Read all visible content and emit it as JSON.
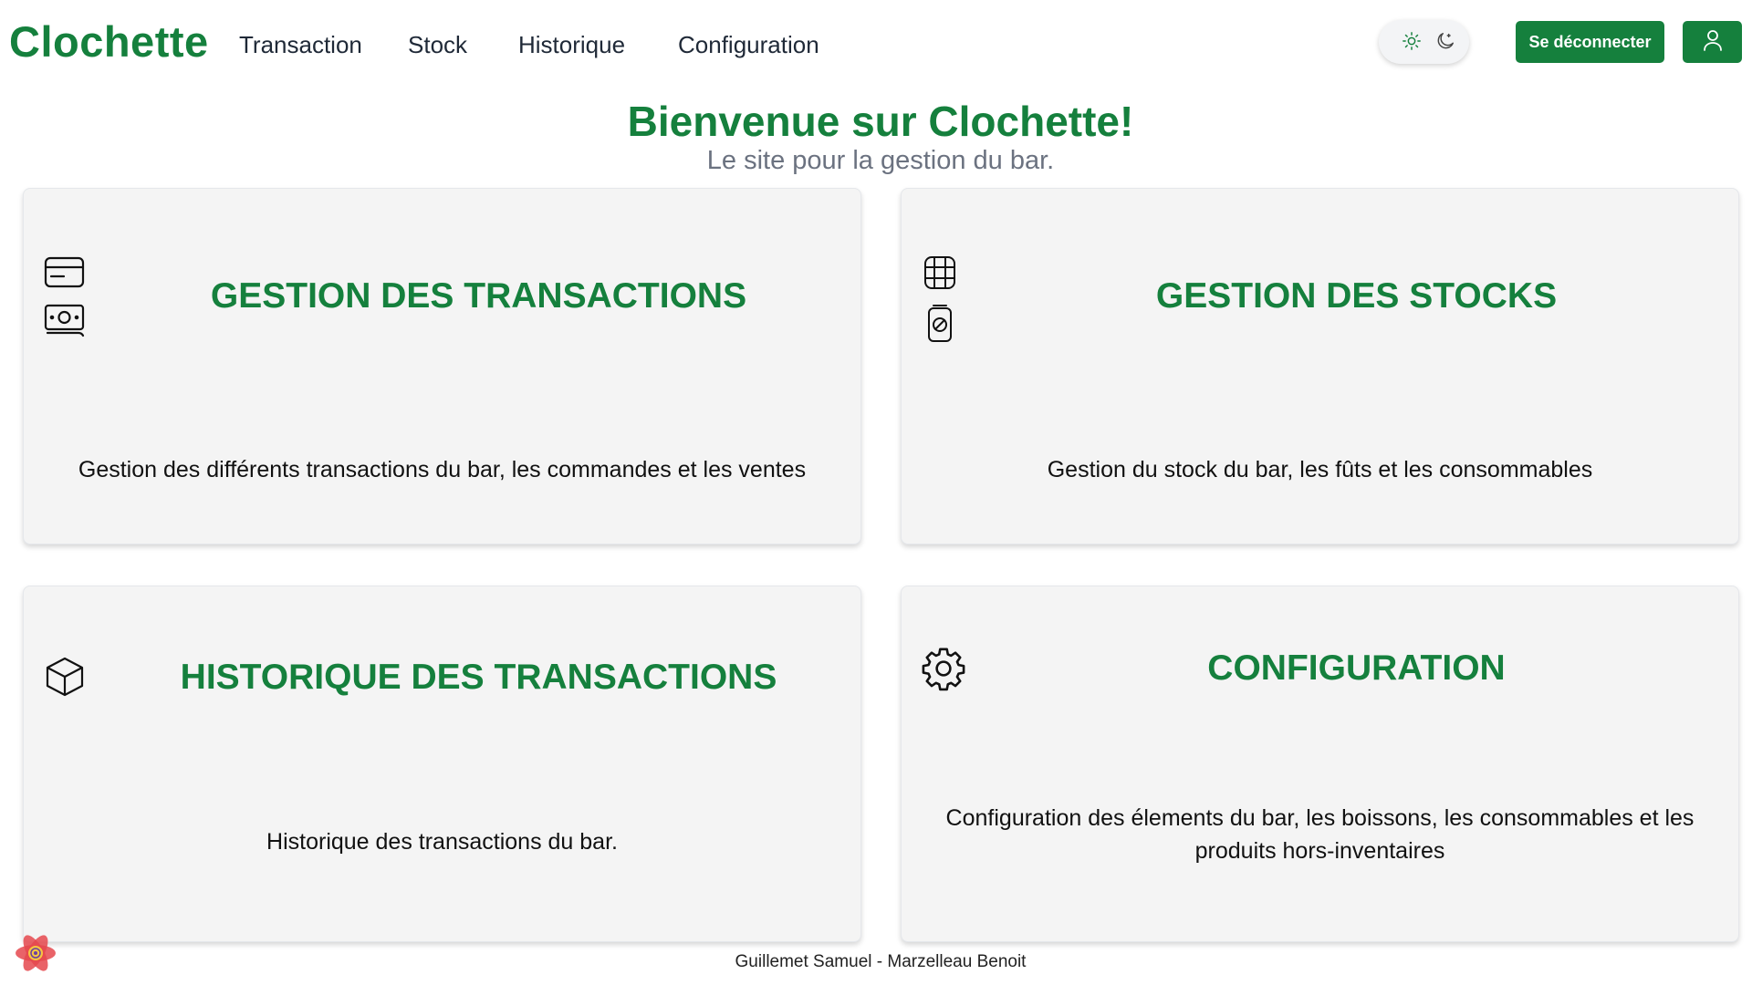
{
  "navbar": {
    "brand": "Clochette",
    "links": [
      "Transaction",
      "Stock",
      "Historique",
      "Configuration"
    ],
    "logout_label": "Se déconnecter"
  },
  "hero": {
    "title": "Bienvenue sur Clochette!",
    "subtitle": "Le site pour la gestion du bar."
  },
  "cards": [
    {
      "title": "GESTION DES TRANSACTIONS",
      "description": "Gestion des différents transactions du bar, les commandes et les ventes",
      "icons": [
        "credit-card-icon",
        "banknote-icon"
      ]
    },
    {
      "title": "GESTION DES STOCKS",
      "description": "Gestion du stock du bar, les fûts et les consommables",
      "icons": [
        "keg-icon",
        "can-icon"
      ]
    },
    {
      "title": "HISTORIQUE DES TRANSACTIONS",
      "description": "Historique des transactions du bar.",
      "icons": [
        "box-icon"
      ]
    },
    {
      "title": "CONFIGURATION",
      "description": "Configuration des élements du bar, les boissons, les consommables et les produits hors-inventaires",
      "icons": [
        "gear-icon"
      ]
    }
  ],
  "footer": {
    "authors": "Guillemet Samuel - Marzelleau Benoit"
  },
  "colors": {
    "brand_green": "#15803d",
    "card_bg": "#f4f4f4",
    "subtitle_gray": "#6b7280"
  }
}
